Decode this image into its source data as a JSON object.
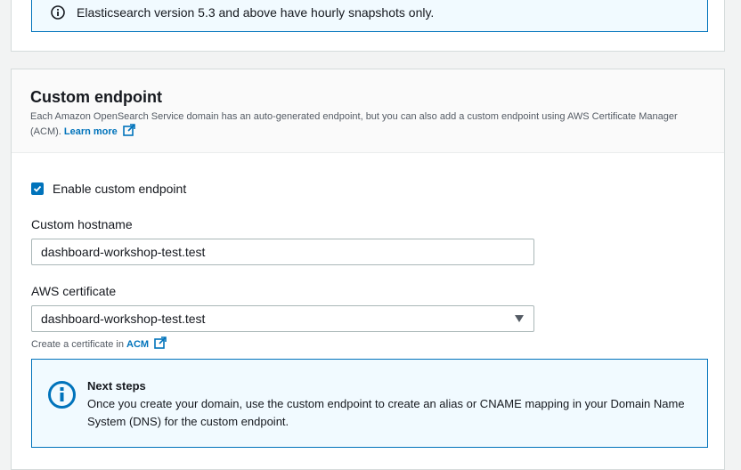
{
  "snapshot_alert": {
    "text": "Elasticsearch version 5.3 and above have hourly snapshots only."
  },
  "custom_endpoint": {
    "title": "Custom endpoint",
    "description": "Each Amazon OpenSearch Service domain has an auto-generated endpoint, but you can also add a custom endpoint using AWS Certificate Manager (ACM).",
    "learn_more": "Learn more",
    "enable_checkbox": {
      "label": "Enable custom endpoint",
      "checked": true
    },
    "hostname": {
      "label": "Custom hostname",
      "value": "dashboard-workshop-test.test"
    },
    "certificate": {
      "label": "AWS certificate",
      "selected": "dashboard-workshop-test.test",
      "hint_prefix": "Create a certificate in",
      "hint_link": "ACM"
    },
    "next_steps": {
      "title": "Next steps",
      "body": "Once you create your domain, use the custom endpoint to create an alias or CNAME mapping in your Domain Name System (DNS) for the custom endpoint."
    }
  },
  "colors": {
    "accent": "#0073bb",
    "info_bg": "#f1faff",
    "page_bg": "#f2f3f3"
  },
  "icons": [
    "info-icon",
    "external-link-icon",
    "check-icon",
    "caret-down-icon"
  ]
}
